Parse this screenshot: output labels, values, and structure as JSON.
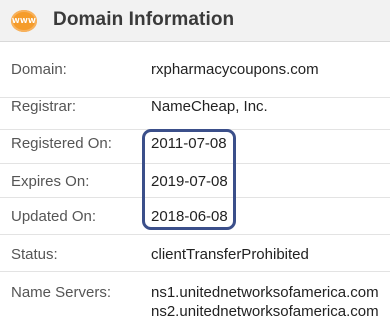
{
  "header": {
    "title": "Domain Information",
    "icon": "www-icon",
    "icon_text": "WWW"
  },
  "rows": [
    {
      "label": "Domain:",
      "value": "rxpharmacycoupons.com"
    },
    {
      "label": "Registrar:",
      "value": "NameCheap, Inc."
    },
    {
      "label": "Registered On:",
      "value": "2011-07-08"
    },
    {
      "label": "Expires On:",
      "value": "2019-07-08"
    },
    {
      "label": "Updated On:",
      "value": "2018-06-08"
    },
    {
      "label": "Status:",
      "value": "clientTransferProhibited"
    },
    {
      "label": "Name Servers:",
      "value": "ns1.unitednetworksofamerica.com",
      "value2": "ns2.unitednetworksofamerica.com"
    }
  ],
  "colors": {
    "accent": "#f59c2b",
    "highlight": "#3b4f8a",
    "header_bg": "#f2f2f2"
  }
}
